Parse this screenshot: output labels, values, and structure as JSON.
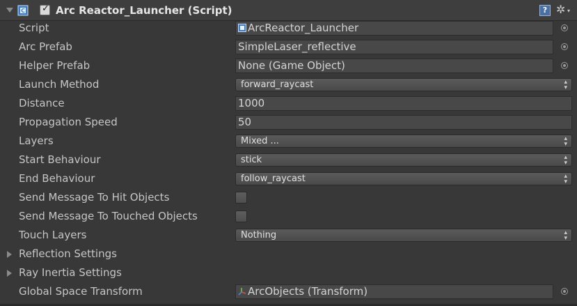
{
  "header": {
    "title": "Arc Reactor_Launcher (Script)",
    "enabled": true,
    "checkmark": "✓",
    "help_label": "?",
    "gear_glyph": "✲",
    "caret_glyph": "▾"
  },
  "fields": {
    "script": {
      "label": "Script",
      "value": "ArcReactor_Launcher"
    },
    "arc_prefab": {
      "label": "Arc Prefab",
      "value": "SimpleLaser_reflective"
    },
    "helper_prefab": {
      "label": "Helper Prefab",
      "value": "None (Game Object)"
    },
    "launch_method": {
      "label": "Launch Method",
      "value": "forward_raycast"
    },
    "distance": {
      "label": "Distance",
      "value": "1000"
    },
    "propagation_speed": {
      "label": "Propagation Speed",
      "value": "50"
    },
    "layers": {
      "label": "Layers",
      "value": "Mixed ..."
    },
    "start_behaviour": {
      "label": "Start Behaviour",
      "value": "stick"
    },
    "end_behaviour": {
      "label": "End Behaviour",
      "value": "follow_raycast"
    },
    "send_message_hit": {
      "label": "Send Message To Hit Objects",
      "checked": false
    },
    "send_message_touched": {
      "label": "Send Message To Touched Objects",
      "checked": false
    },
    "touch_layers": {
      "label": "Touch Layers",
      "value": "Nothing"
    },
    "reflection_settings": {
      "label": "Reflection Settings"
    },
    "ray_inertia_settings": {
      "label": "Ray Inertia Settings"
    },
    "global_space_transform": {
      "label": "Global Space Transform",
      "value": "ArcObjects (Transform)"
    }
  },
  "dropdown_arrows": "▴\n▾",
  "colors": {
    "background": "#383838",
    "field": "#484848",
    "accent_script_icon": "#4a86c8"
  }
}
